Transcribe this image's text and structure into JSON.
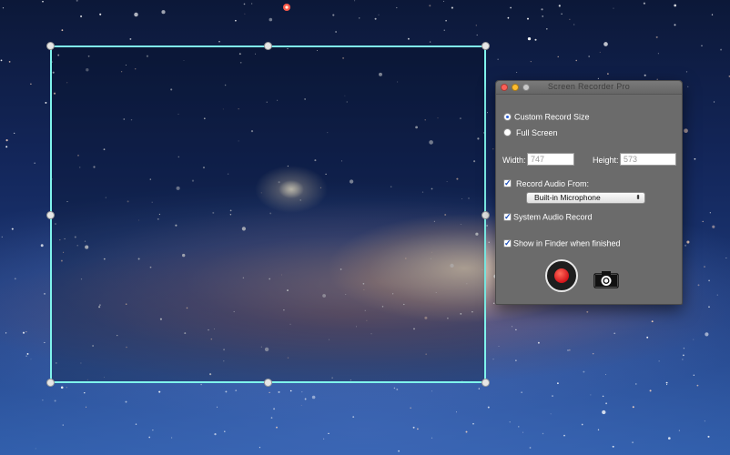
{
  "window": {
    "title": "Screen Recorder Pro",
    "traffic_lights": [
      "#fb5f57",
      "#fdbc2e",
      "#c8c8c8"
    ]
  },
  "options": {
    "custom_size_label": "Custom Record Size",
    "custom_size_selected": true,
    "full_screen_label": "Full Screen",
    "full_screen_selected": false
  },
  "dimensions": {
    "width_label": "Width:",
    "width_value": "747",
    "height_label": "Height:",
    "height_value": "573"
  },
  "audio": {
    "record_audio_label": "Record Audio From:",
    "record_audio_checked": true,
    "source_selected": "Built-in Microphone",
    "system_audio_label": "System Audio Record",
    "system_audio_checked": true
  },
  "finder": {
    "show_in_finder_label": "Show in Finder when finished",
    "show_in_finder_checked": true
  },
  "icons": {
    "record": "record-icon",
    "screenshot": "camera-icon",
    "check": "✓",
    "dropdown_arrows": "⬍"
  },
  "colors": {
    "selection_border": "#7ff3ec",
    "record_red": "#d4141a"
  }
}
